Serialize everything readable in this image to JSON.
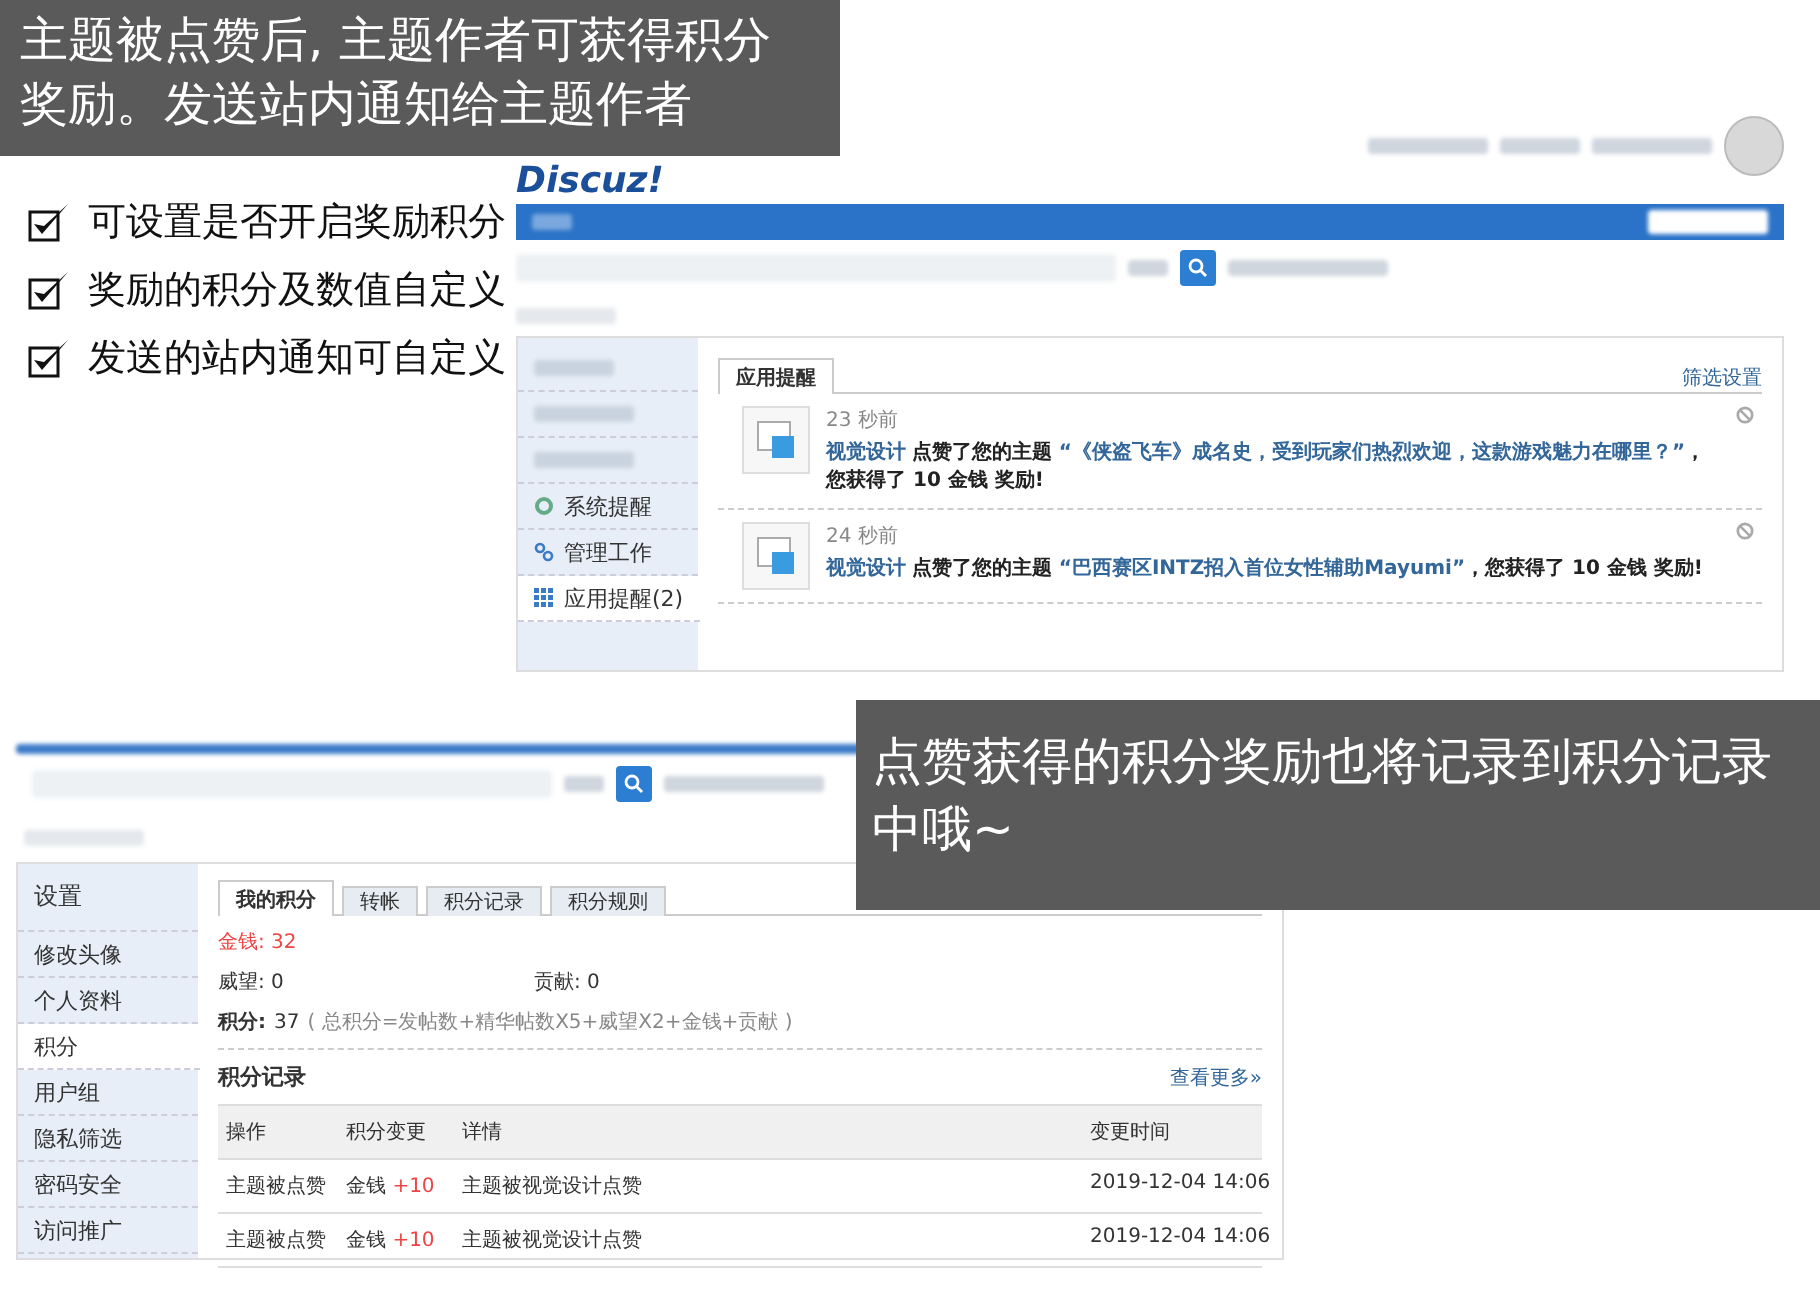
{
  "caption_top": "主题被点赞后, 主题作者可获得积分奖励。发送站内通知给主题作者",
  "features": [
    "可设置是否开启奖励积分",
    "奖励的积分及数值自定义",
    "发送的站内通知可自定义"
  ],
  "caption_bottom": "点赞获得的积分奖励也将记录到积分记录中哦~",
  "notice_screen": {
    "logo": "Discuz!",
    "sidebar": [
      {
        "label": "系统提醒",
        "selected": false
      },
      {
        "label": "管理工作",
        "selected": false
      },
      {
        "label": "应用提醒(2)",
        "selected": true
      }
    ],
    "tab": "应用提醒",
    "filter_link": "筛选设置",
    "notifications": [
      {
        "time": "23 秒前",
        "user": "视觉设计",
        "action": "点赞了您的主题",
        "topic": "“《侠盗飞车》成名史，受到玩家们热烈欢迎，这款游戏魅力在哪里？”",
        "reward": "，您获得了 10 金钱 奖励!"
      },
      {
        "time": "24 秒前",
        "user": "视觉设计",
        "action": "点赞了您的主题",
        "topic": "“巴西赛区INTZ招入首位女性辅助Mayumi”",
        "reward": "，您获得了 10 金钱 奖励!"
      }
    ]
  },
  "credits_screen": {
    "sidebar_title": "设置",
    "sidebar": [
      {
        "label": "修改头像",
        "selected": false
      },
      {
        "label": "个人资料",
        "selected": false
      },
      {
        "label": "积分",
        "selected": true
      },
      {
        "label": "用户组",
        "selected": false
      },
      {
        "label": "隐私筛选",
        "selected": false
      },
      {
        "label": "密码安全",
        "selected": false
      },
      {
        "label": "访问推广",
        "selected": false
      }
    ],
    "tabs": [
      {
        "label": "我的积分",
        "selected": true
      },
      {
        "label": "转帐",
        "selected": false
      },
      {
        "label": "积分记录",
        "selected": false
      },
      {
        "label": "积分规则",
        "selected": false
      }
    ],
    "money": "金钱: 32",
    "prestige": "威望: 0",
    "contribution": "贡献: 0",
    "total_label": "积分:",
    "total_value": "37",
    "formula": "( 总积分=发帖数+精华帖数X5+威望X2+金钱+贡献 )",
    "log_title": "积分记录",
    "more_link": "查看更多»",
    "columns": [
      "操作",
      "积分变更",
      "详情",
      "变更时间"
    ],
    "rows": [
      {
        "action": "主题被点赞",
        "credit": "金钱",
        "amount": "+10",
        "detail": "主题被视觉设计点赞",
        "time": "2019-12-04 14:06"
      },
      {
        "action": "主题被点赞",
        "credit": "金钱",
        "amount": "+10",
        "detail": "主题被视觉设计点赞",
        "time": "2019-12-04 14:06"
      }
    ]
  }
}
